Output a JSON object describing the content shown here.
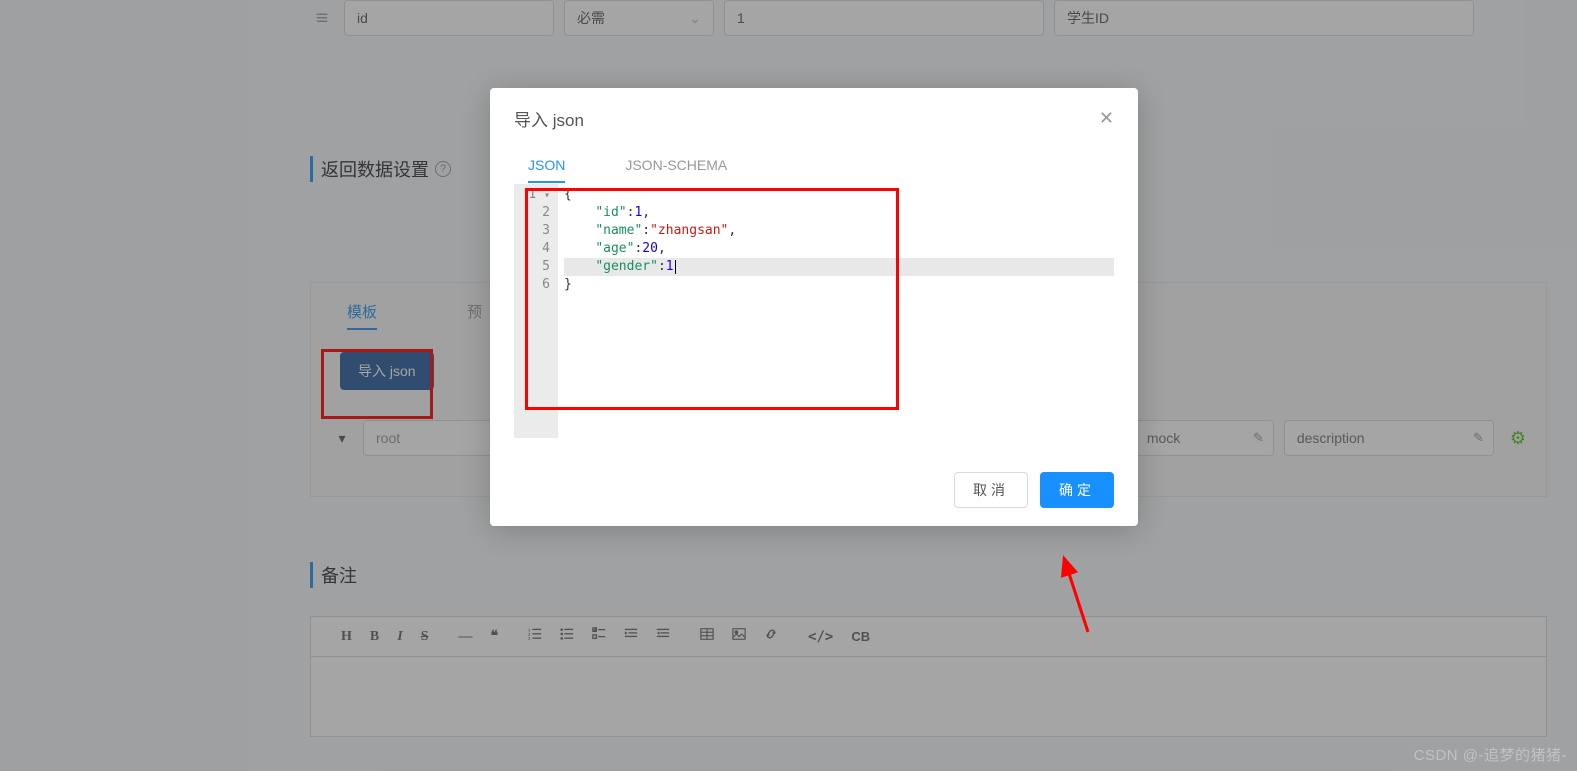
{
  "params": {
    "drag_icon": "drag-icon",
    "name": "id",
    "required_label": "必需",
    "example": "1",
    "desc": "学生ID"
  },
  "return_data_section": {
    "title": "返回数据设置",
    "help": "?"
  },
  "resp_panel": {
    "tabs": {
      "template": "模板",
      "preview_prefix": "预"
    },
    "import_button": "导入 json",
    "schema": {
      "root": "root",
      "mock_placeholder": "mock",
      "desc_placeholder": "description"
    }
  },
  "notes_section": {
    "title": "备注"
  },
  "toolbar": {
    "h": "H",
    "b": "B",
    "i": "I",
    "s": "S",
    "hr": "—",
    "quote": "❝",
    "ol": "list-ol",
    "ul": "list-ul",
    "check": "list-check",
    "indent_r": "indent-right",
    "indent_l": "indent-left",
    "table": "table",
    "image": "image",
    "link": "link",
    "code": "</>",
    "cb": "CB"
  },
  "modal": {
    "title": "导入 json",
    "tabs": {
      "json": "JSON",
      "schema": "JSON-SCHEMA"
    },
    "cancel": "取消",
    "ok": "确定",
    "code": {
      "line1": "{",
      "line2_key": "\"id\"",
      "line2_val": "1",
      "line3_key": "\"name\"",
      "line3_val": "\"zhangsan\"",
      "line4_key": "\"age\"",
      "line4_val": "20",
      "line5_key": "\"gender\"",
      "line5_val": "1",
      "line6": "}"
    },
    "gutter": [
      "1",
      "2",
      "3",
      "4",
      "5",
      "6"
    ]
  },
  "watermark": "CSDN @-追梦的猪猪-"
}
